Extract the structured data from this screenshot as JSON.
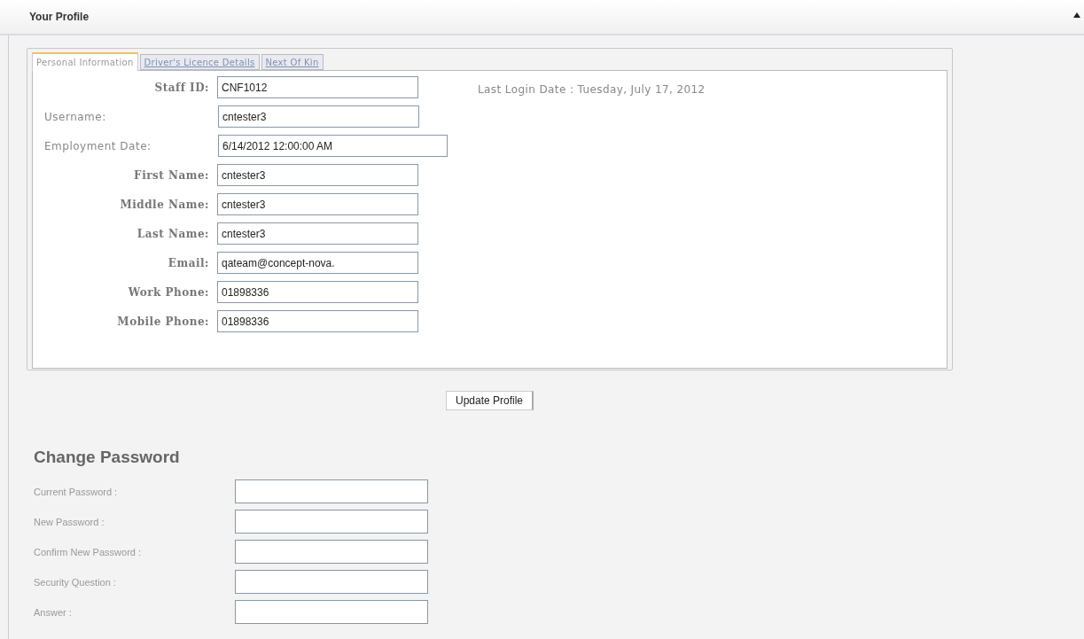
{
  "header": {
    "title": "Your Profile",
    "collapsed": false
  },
  "tabs": [
    {
      "label": "Personal Information",
      "selected": true
    },
    {
      "label": "Driver's Licence Details",
      "selected": false
    },
    {
      "label": "Next Of Kin",
      "selected": false
    }
  ],
  "profile_fields": [
    {
      "label": "Staff ID:",
      "value": "CNF1012",
      "bold": true,
      "wide": false
    },
    {
      "label": "Username:",
      "value": "cntester3",
      "bold": false,
      "wide": false
    },
    {
      "label": "Employment Date:",
      "value": "6/14/2012 12:00:00 AM",
      "bold": false,
      "wide": true
    },
    {
      "label": "First Name:",
      "value": "cntester3",
      "bold": true,
      "wide": false
    },
    {
      "label": "Middle Name:",
      "value": "cntester3",
      "bold": true,
      "wide": false
    },
    {
      "label": "Last Name:",
      "value": "cntester3",
      "bold": true,
      "wide": false
    },
    {
      "label": "Email:",
      "value": "qateam@concept-nova.",
      "bold": true,
      "wide": false
    },
    {
      "label": "Work Phone:",
      "value": "01898336",
      "bold": true,
      "wide": false
    },
    {
      "label": "Mobile Phone:",
      "value": "01898336",
      "bold": true,
      "wide": false
    }
  ],
  "last_login": "Last Login Date : Tuesday, July 17, 2012",
  "update_button": "Update Profile",
  "change_password": {
    "title": "Change Password",
    "fields": [
      {
        "label": "Current Password :"
      },
      {
        "label": "New Password :"
      },
      {
        "label": "Confirm New Password :"
      },
      {
        "label": "Security Question :"
      },
      {
        "label": "Answer :"
      }
    ]
  }
}
